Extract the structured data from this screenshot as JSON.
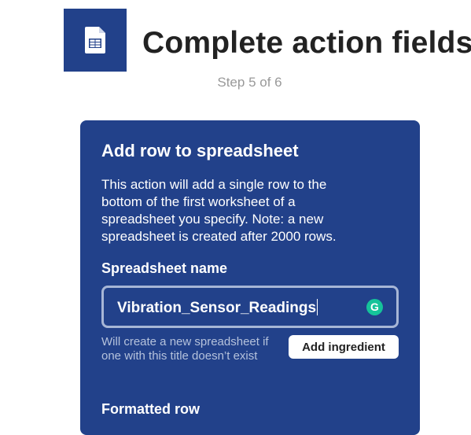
{
  "header": {
    "title": "Complete action fields",
    "step": "Step 5 of 6",
    "service_icon": "spreadsheet-icon",
    "service_color": "#22418a"
  },
  "action_card": {
    "title": "Add row to spreadsheet",
    "description": "This action will add a single row to the bottom of the first worksheet of a spreadsheet you specify. Note: a new spreadsheet is created after 2000 rows.",
    "background_color": "#22418a",
    "fields": {
      "spreadsheet_name": {
        "label": "Spreadsheet name",
        "value": "Vibration_Sensor_Readings",
        "helper": "Will create a new spreadsheet if one with this title doesn’t exist",
        "add_ingredient_label": "Add ingredient",
        "extension_icon": "grammarly-icon",
        "extension_icon_glyph": "G",
        "extension_color": "#15c39a"
      },
      "formatted_row": {
        "label": "Formatted row"
      }
    }
  }
}
